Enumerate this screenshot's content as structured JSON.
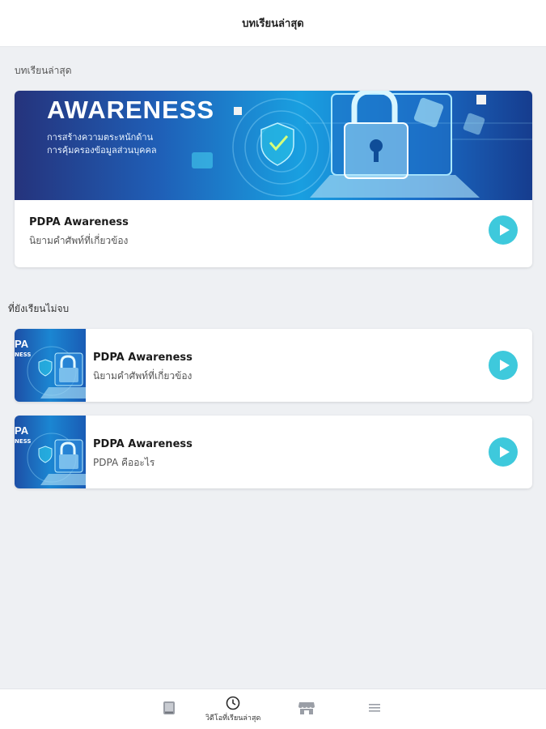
{
  "header": {
    "title": "บทเรียนล่าสุด"
  },
  "sections": {
    "recent_label": "บทเรียนล่าสุด",
    "unfinished_label": "ที่ยังเรียนไม่จบ"
  },
  "hero": {
    "banner_title": "AWARENESS",
    "banner_sub_line1": "การสร้างความตระหนักด้าน",
    "banner_sub_line2": "การคุ้มครองข้อมูลส่วนบุคคล",
    "title": "PDPA Awareness",
    "subtitle": "นิยามคำศัพท์ที่เกี่ยวข้อง"
  },
  "unfinished": [
    {
      "title": "PDPA Awareness",
      "subtitle": "นิยามคำศัพท์ที่เกี่ยวข้อง",
      "thumb_text": "PA",
      "thumb_text2": "NESS"
    },
    {
      "title": "PDPA Awareness",
      "subtitle": "PDPA คืออะไร",
      "thumb_text": "PA",
      "thumb_text2": "NESS"
    }
  ],
  "bottom_nav": {
    "active_label": "วิดีโอที่เรียนล่าสุด"
  },
  "colors": {
    "accent": "#3ec9dc",
    "background": "#eef0f3"
  },
  "icons": [
    "book-icon",
    "clock-icon",
    "store-icon",
    "menu-icon",
    "play-icon"
  ]
}
